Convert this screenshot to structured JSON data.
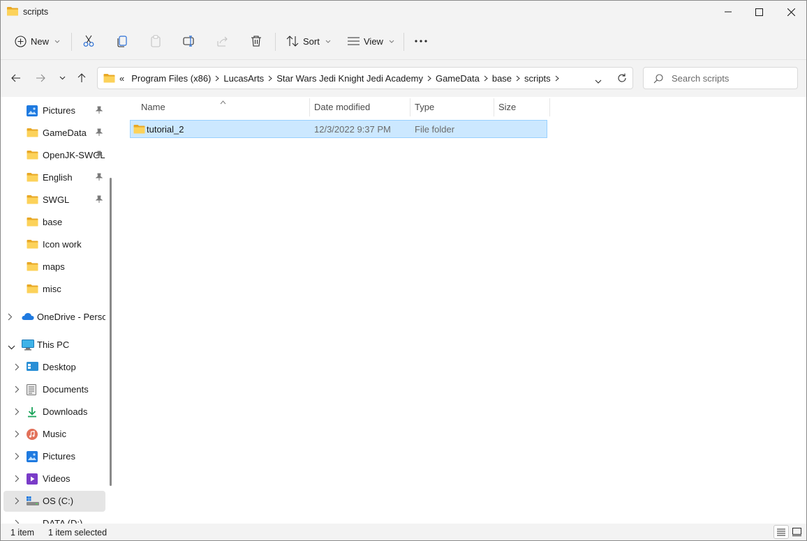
{
  "window": {
    "title": "scripts"
  },
  "commandbar": {
    "new_label": "New",
    "sort_label": "Sort",
    "view_label": "View"
  },
  "address": {
    "overflow": "«",
    "crumbs": [
      "Program Files (x86)",
      "LucasArts",
      "Star Wars Jedi Knight Jedi Academy",
      "GameData",
      "base",
      "scripts"
    ]
  },
  "search": {
    "placeholder": "Search scripts"
  },
  "nav": {
    "quick_access": [
      {
        "label": "Pictures",
        "icon": "pictures-icon",
        "pinned": true
      },
      {
        "label": "GameData",
        "icon": "folder-icon",
        "pinned": true
      },
      {
        "label": "OpenJK-SWGL",
        "icon": "folder-icon",
        "pinned": true
      },
      {
        "label": "English",
        "icon": "folder-icon",
        "pinned": true
      },
      {
        "label": "SWGL",
        "icon": "folder-icon",
        "pinned": true
      },
      {
        "label": "base",
        "icon": "folder-icon",
        "pinned": false
      },
      {
        "label": "Icon work",
        "icon": "folder-icon",
        "pinned": false
      },
      {
        "label": "maps",
        "icon": "folder-icon",
        "pinned": false
      },
      {
        "label": "misc",
        "icon": "folder-icon",
        "pinned": false
      }
    ],
    "onedrive_label": "OneDrive - Personal",
    "thispc_label": "This PC",
    "thispc_items": [
      {
        "label": "Desktop",
        "icon": "desktop-icon"
      },
      {
        "label": "Documents",
        "icon": "documents-icon"
      },
      {
        "label": "Downloads",
        "icon": "downloads-icon"
      },
      {
        "label": "Music",
        "icon": "music-icon"
      },
      {
        "label": "Pictures",
        "icon": "pictures-icon"
      },
      {
        "label": "Videos",
        "icon": "videos-icon"
      },
      {
        "label": "OS (C:)",
        "icon": "drive-icon"
      },
      {
        "label": "DATA (D:)",
        "icon": "drive-icon"
      }
    ]
  },
  "list": {
    "columns": [
      "Name",
      "Date modified",
      "Type",
      "Size"
    ],
    "rows": [
      {
        "name": "tutorial_2",
        "date": "12/3/2022 9:37 PM",
        "type": "File folder",
        "size": ""
      }
    ]
  },
  "status": {
    "count": "1 item",
    "selected": "1 item selected"
  },
  "colors": {
    "accent": "#0067c0",
    "selection_bg": "#cce8ff",
    "selection_border": "#99d1ff",
    "folder": "#f8c74a"
  }
}
